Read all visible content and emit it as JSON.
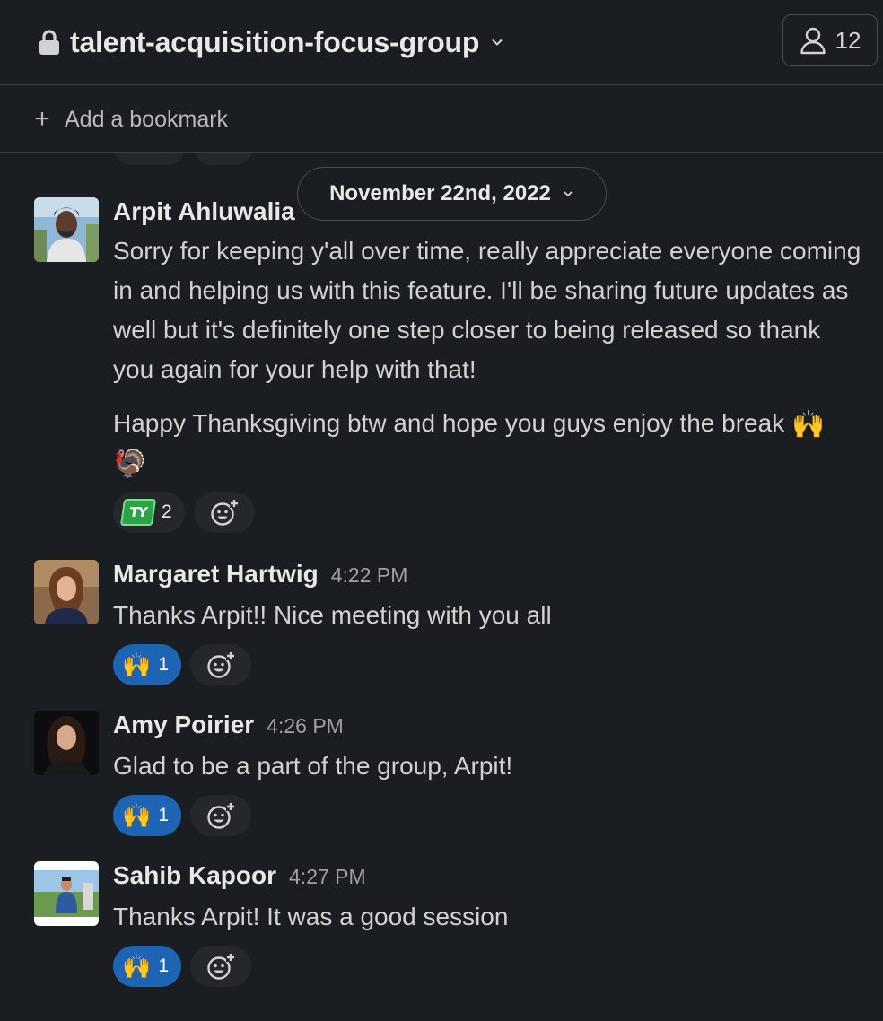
{
  "header": {
    "channel_name": "talent-acquisition-focus-group",
    "member_count": "12"
  },
  "bookmark_bar": {
    "plus": "+",
    "label": "Add a bookmark"
  },
  "date_divider": {
    "label": "November 22nd, 2022"
  },
  "messages": [
    {
      "author": "Arpit Ahluwalia",
      "time": "",
      "paragraphs": [
        "Sorry for keeping y'all over time, really appreciate everyone coming in and helping us with this feature. I'll be sharing future updates as well but it's definitely one step closer to being released so thank you again for your help with that!",
        "Happy Thanksgiving btw and hope you guys enjoy the break"
      ],
      "inline_emoji": [
        "🙌",
        "🦃"
      ],
      "reaction": {
        "emoji": "ty",
        "emoji_text": "TY",
        "count": "2",
        "active": false
      }
    },
    {
      "author": "Margaret Hartwig",
      "time": "4:22 PM",
      "text": "Thanks Arpit!! Nice meeting with you all",
      "reaction": {
        "emoji": "🙌",
        "count": "1",
        "active": true
      }
    },
    {
      "author": "Amy Poirier",
      "time": "4:26 PM",
      "text": "Glad to be a part of the group, Arpit!",
      "reaction": {
        "emoji": "🙌",
        "count": "1",
        "active": true
      }
    },
    {
      "author": "Sahib Kapoor",
      "time": "4:27 PM",
      "text": "Thanks Arpit! It was a good session",
      "reaction": {
        "emoji": "🙌",
        "count": "1",
        "active": true
      }
    }
  ],
  "icons": {
    "lock": "lock-icon",
    "chevron": "chevron-down-icon",
    "members": "person-icon",
    "add_reaction": "add-reaction-icon"
  },
  "colors": {
    "background": "#1a1d21",
    "active_reaction": "#1d65b3",
    "reaction": "#24272b",
    "divider": "#3b3d42"
  }
}
